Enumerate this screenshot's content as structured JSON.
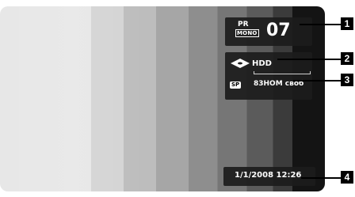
{
  "osd": {
    "channel": {
      "pr_label": "PR",
      "audio_mode": "MONO",
      "number": "07"
    },
    "source": {
      "device": "HDD",
      "icon": "disc-icon",
      "record_mode": "SP",
      "remaining": "83HOM своб"
    },
    "clock": {
      "datetime": "1/1/2008 12:26"
    }
  },
  "callouts": [
    "1",
    "2",
    "3",
    "4"
  ],
  "colors": {
    "osd_background": "#1c1c1c",
    "callout": "#000000"
  }
}
